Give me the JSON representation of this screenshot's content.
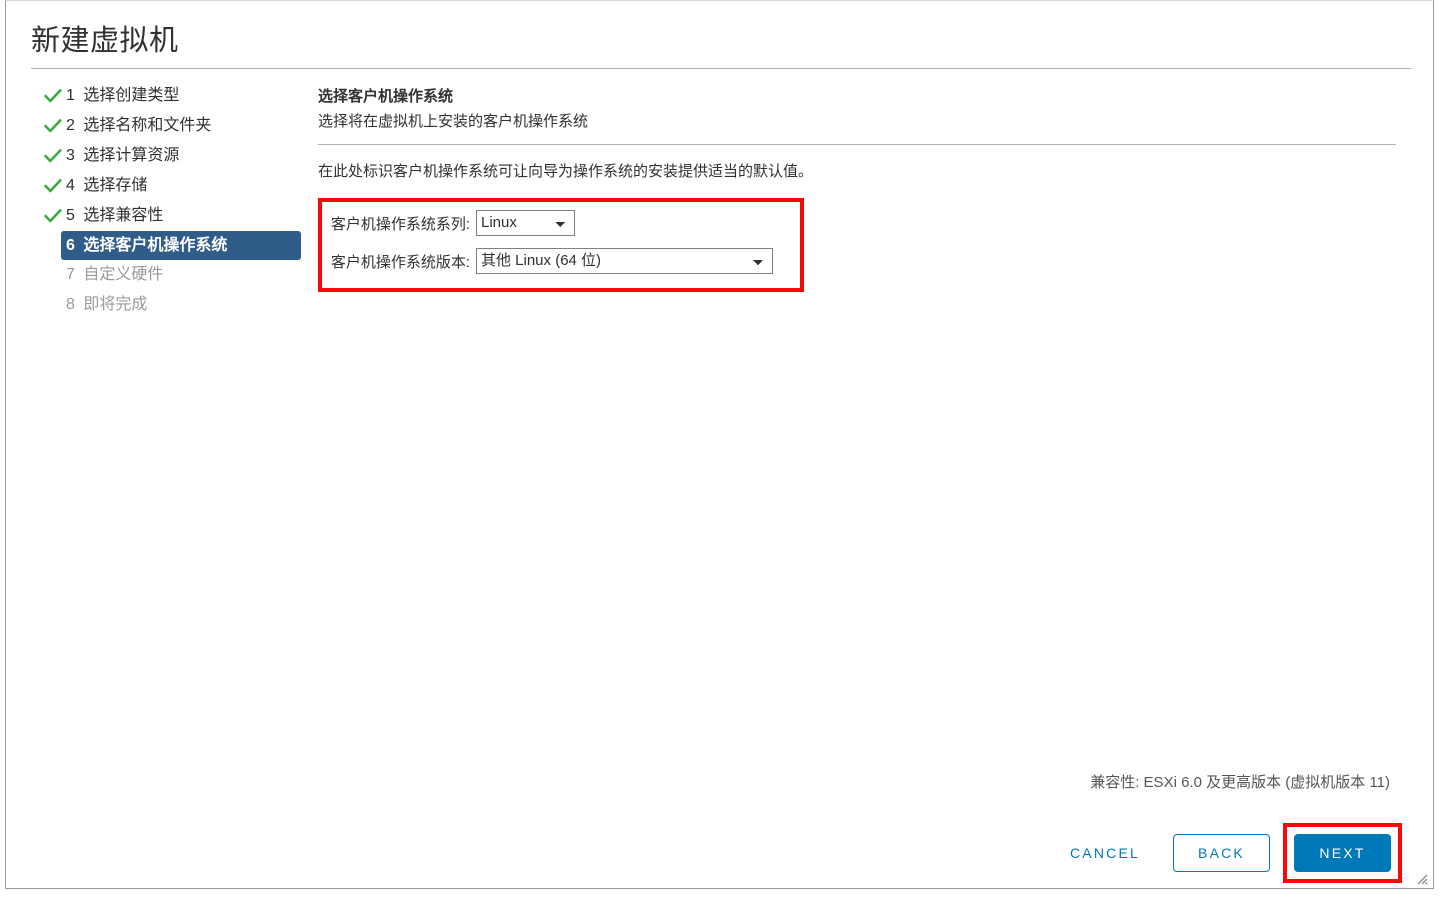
{
  "window": {
    "title": "新建虚拟机",
    "resize_grip_icon": "resize-grip-icon"
  },
  "steps": [
    {
      "number": "1",
      "label": "选择创建类型",
      "state": "done",
      "icon": "check-icon"
    },
    {
      "number": "2",
      "label": "选择名称和文件夹",
      "state": "done",
      "icon": "check-icon"
    },
    {
      "number": "3",
      "label": "选择计算资源",
      "state": "done",
      "icon": "check-icon"
    },
    {
      "number": "4",
      "label": "选择存储",
      "state": "done",
      "icon": "check-icon"
    },
    {
      "number": "5",
      "label": "选择兼容性",
      "state": "done",
      "icon": "check-icon"
    },
    {
      "number": "6",
      "label": "选择客户机操作系统",
      "state": "active",
      "icon": ""
    },
    {
      "number": "7",
      "label": "自定义硬件",
      "state": "pending",
      "icon": ""
    },
    {
      "number": "8",
      "label": "即将完成",
      "state": "pending",
      "icon": ""
    }
  ],
  "content": {
    "heading": "选择客户机操作系统",
    "subheading": "选择将在虚拟机上安装的客户机操作系统",
    "description": "在此处标识客户机操作系统可让向导为操作系统的安装提供适当的默认值。"
  },
  "form": {
    "guest_os_family": {
      "label": "客户机操作系统系列:",
      "value": "Linux",
      "options": [
        "Linux"
      ]
    },
    "guest_os_version": {
      "label": "客户机操作系统版本:",
      "value": "其他 Linux (64 位)",
      "options": [
        "其他 Linux (64 位)"
      ]
    }
  },
  "status": {
    "compatibility": "兼容性: ESXi 6.0 及更高版本 (虚拟机版本 11)"
  },
  "footer": {
    "cancel_label": "CANCEL",
    "back_label": "BACK",
    "next_label": "NEXT"
  },
  "colors": {
    "accent_blue": "#0079b8",
    "active_step_bg": "#2f5c88",
    "check_green": "#3faa3f",
    "highlight_red": "#fb0707",
    "text": "#313131",
    "muted_text": "#9a9a9a"
  }
}
